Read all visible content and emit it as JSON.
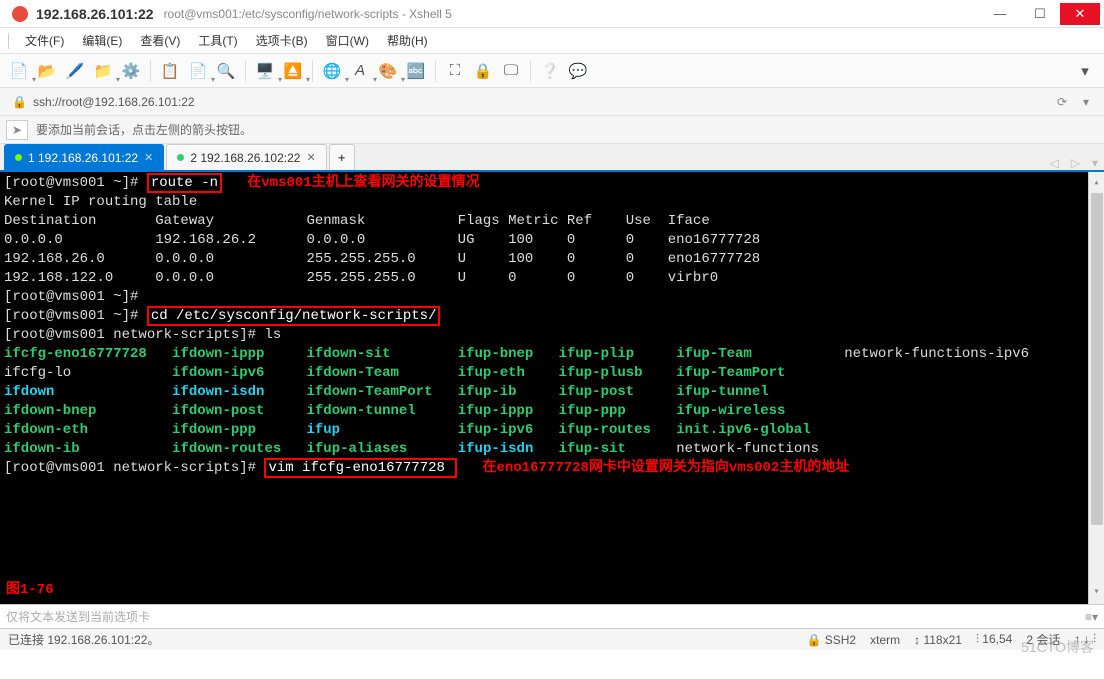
{
  "window": {
    "title": "192.168.26.101:22",
    "subtitle": "root@vms001:/etc/sysconfig/network-scripts - Xshell 5"
  },
  "menu": [
    "文件(F)",
    "编辑(E)",
    "查看(V)",
    "工具(T)",
    "选项卡(B)",
    "窗口(W)",
    "帮助(H)"
  ],
  "address": {
    "url": "ssh://root@192.168.26.101:22"
  },
  "hint": "要添加当前会话，点击左侧的箭头按钮。",
  "tabs": [
    {
      "label": "1 192.168.26.101:22",
      "active": true
    },
    {
      "label": "2 192.168.26.102:22",
      "active": false
    }
  ],
  "term": {
    "p1": "[root@vms001 ~]# ",
    "cmd1": "route -n",
    "anno1": "在vms001主机上查看网关的设置情况",
    "hdr": "Kernel IP routing table",
    "cols": [
      "Destination",
      "Gateway",
      "Genmask",
      "Flags",
      "Metric",
      "Ref",
      "Use",
      "Iface"
    ],
    "rows": [
      [
        "0.0.0.0",
        "192.168.26.2",
        "0.0.0.0",
        "UG",
        "100",
        "0",
        "0",
        "eno16777728"
      ],
      [
        "192.168.26.0",
        "0.0.0.0",
        "255.255.255.0",
        "U",
        "100",
        "0",
        "0",
        "eno16777728"
      ],
      [
        "192.168.122.0",
        "0.0.0.0",
        "255.255.255.0",
        "U",
        "0",
        "0",
        "0",
        "virbr0"
      ]
    ],
    "p2": "[root@vms001 ~]#",
    "p3": "[root@vms001 ~]# ",
    "cmd2": "cd /etc/sysconfig/network-scripts/",
    "p4": "[root@vms001 network-scripts]# ls",
    "ls": [
      [
        [
          "ifcfg-eno16777728",
          "g"
        ],
        [
          "ifdown-ippp",
          "g"
        ],
        [
          "ifdown-sit",
          "g"
        ],
        [
          "ifup-bnep",
          "g"
        ],
        [
          "ifup-plip",
          "g"
        ],
        [
          "ifup-Team",
          "g"
        ],
        [
          "network-functions-ipv6",
          "w"
        ]
      ],
      [
        [
          "ifcfg-lo",
          "w"
        ],
        [
          "ifdown-ipv6",
          "g"
        ],
        [
          "ifdown-Team",
          "g"
        ],
        [
          "ifup-eth",
          "g"
        ],
        [
          "ifup-plusb",
          "g"
        ],
        [
          "ifup-TeamPort",
          "g"
        ],
        [
          "",
          ""
        ]
      ],
      [
        [
          "ifdown",
          "c"
        ],
        [
          "ifdown-isdn",
          "c"
        ],
        [
          "ifdown-TeamPort",
          "g"
        ],
        [
          "ifup-ib",
          "g"
        ],
        [
          "ifup-post",
          "g"
        ],
        [
          "ifup-tunnel",
          "g"
        ],
        [
          "",
          ""
        ]
      ],
      [
        [
          "ifdown-bnep",
          "g"
        ],
        [
          "ifdown-post",
          "g"
        ],
        [
          "ifdown-tunnel",
          "g"
        ],
        [
          "ifup-ippp",
          "g"
        ],
        [
          "ifup-ppp",
          "g"
        ],
        [
          "ifup-wireless",
          "g"
        ],
        [
          "",
          ""
        ]
      ],
      [
        [
          "ifdown-eth",
          "g"
        ],
        [
          "ifdown-ppp",
          "g"
        ],
        [
          "ifup",
          "c"
        ],
        [
          "ifup-ipv6",
          "g"
        ],
        [
          "ifup-routes",
          "g"
        ],
        [
          "init.ipv6-global",
          "g"
        ],
        [
          "",
          ""
        ]
      ],
      [
        [
          "ifdown-ib",
          "g"
        ],
        [
          "ifdown-routes",
          "g"
        ],
        [
          "ifup-aliases",
          "g"
        ],
        [
          "ifup-isdn",
          "c"
        ],
        [
          "ifup-sit",
          "g"
        ],
        [
          "network-functions",
          "w"
        ],
        [
          "",
          ""
        ]
      ]
    ],
    "p5": "[root@vms001 network-scripts]# ",
    "cmd3": "vim ifcfg-eno16777728 ",
    "anno2": "在eno16777728网卡中设置网关为指向vms002主机的地址",
    "fig": "图1-76"
  },
  "sendbar": "仅将文本发送到当前选项卡",
  "status": {
    "conn": "已连接 192.168.26.101:22。",
    "proto": "SSH2",
    "term": "xterm",
    "size": "118x21",
    "pos": "16,54",
    "sess": "2 会话"
  },
  "watermark": "51CTO博客",
  "toolbar_icons": [
    "new",
    "open",
    "prop",
    "copy",
    "paste",
    "find",
    "|",
    "recon",
    "discon",
    "|",
    "print",
    "|",
    "lang",
    "font",
    "color",
    "bold",
    "|",
    "fs",
    "lock",
    "scrn",
    "|",
    "help",
    "chat"
  ]
}
